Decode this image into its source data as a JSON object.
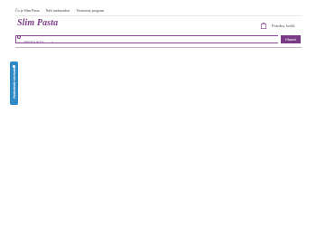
{
  "top_links": [
    "Čo je Slim Pasta",
    "Naši ambasádori",
    "Vernostný program"
  ],
  "logo": {
    "text": "Slim Pasta"
  },
  "cart": {
    "label": "Prázdny košík",
    "icon": "shopping-bag-icon"
  },
  "search": {
    "placeholder": "",
    "button_label": "Hľadať"
  },
  "nav": {
    "products_label": "PRODUKTY",
    "icon": "grid-icon"
  },
  "side_tab": {
    "text": "Hodnotenie obchodu",
    "color": "#2f8ac6"
  },
  "colors": {
    "brand": "#7b3a86"
  }
}
